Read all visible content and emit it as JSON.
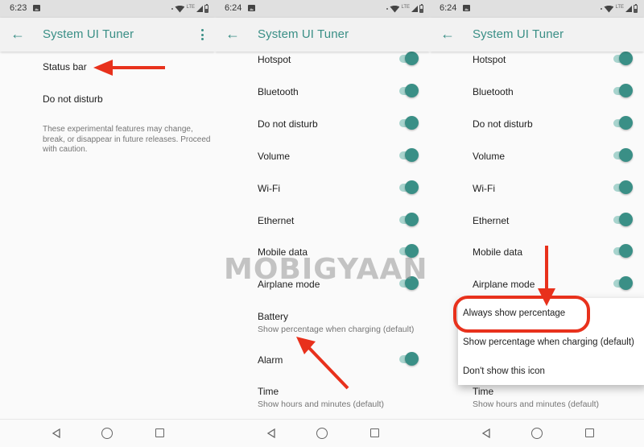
{
  "panels": [
    {
      "status_time": "6:23",
      "title": "System UI Tuner",
      "items": [
        {
          "label": "Status bar"
        },
        {
          "label": "Do not disturb"
        }
      ],
      "note": "These experimental features may change, break, or disappear in future releases. Proceed with caution."
    },
    {
      "status_time": "6:24",
      "title": "System UI Tuner",
      "items": [
        {
          "label": "Hotspot",
          "toggle": true
        },
        {
          "label": "Bluetooth",
          "toggle": true
        },
        {
          "label": "Do not disturb",
          "toggle": true
        },
        {
          "label": "Volume",
          "toggle": true
        },
        {
          "label": "Wi-Fi",
          "toggle": true
        },
        {
          "label": "Ethernet",
          "toggle": true
        },
        {
          "label": "Mobile data",
          "toggle": true
        },
        {
          "label": "Airplane mode",
          "toggle": true
        },
        {
          "label": "Battery",
          "sub": "Show percentage when charging (default)"
        },
        {
          "label": "Alarm",
          "toggle": true
        },
        {
          "label": "Time",
          "sub": "Show hours and minutes (default)"
        }
      ]
    },
    {
      "status_time": "6:24",
      "title": "System UI Tuner",
      "items": [
        {
          "label": "Hotspot",
          "toggle": true
        },
        {
          "label": "Bluetooth",
          "toggle": true
        },
        {
          "label": "Do not disturb",
          "toggle": true
        },
        {
          "label": "Volume",
          "toggle": true
        },
        {
          "label": "Wi-Fi",
          "toggle": true
        },
        {
          "label": "Ethernet",
          "toggle": true
        },
        {
          "label": "Mobile data",
          "toggle": true
        },
        {
          "label": "Airplane mode",
          "toggle": true
        },
        {
          "label": "Time",
          "sub": "Show hours and minutes (default)"
        }
      ],
      "battery_menu": [
        "Always show percentage",
        "Show percentage when charging (default)",
        "Don't show this icon"
      ]
    }
  ],
  "status_icons": [
    "image-icon",
    "wifi-icon",
    "lte-label",
    "signal-icon",
    "battery-icon"
  ],
  "status_lte": "LTE",
  "nav": [
    "back-icon",
    "home-icon",
    "recents-icon"
  ],
  "watermark": "MOBIGYAAN",
  "colors": {
    "accent": "#3a8f86",
    "annotation": "#e8311c",
    "switch_track": "#a8d4ce"
  }
}
